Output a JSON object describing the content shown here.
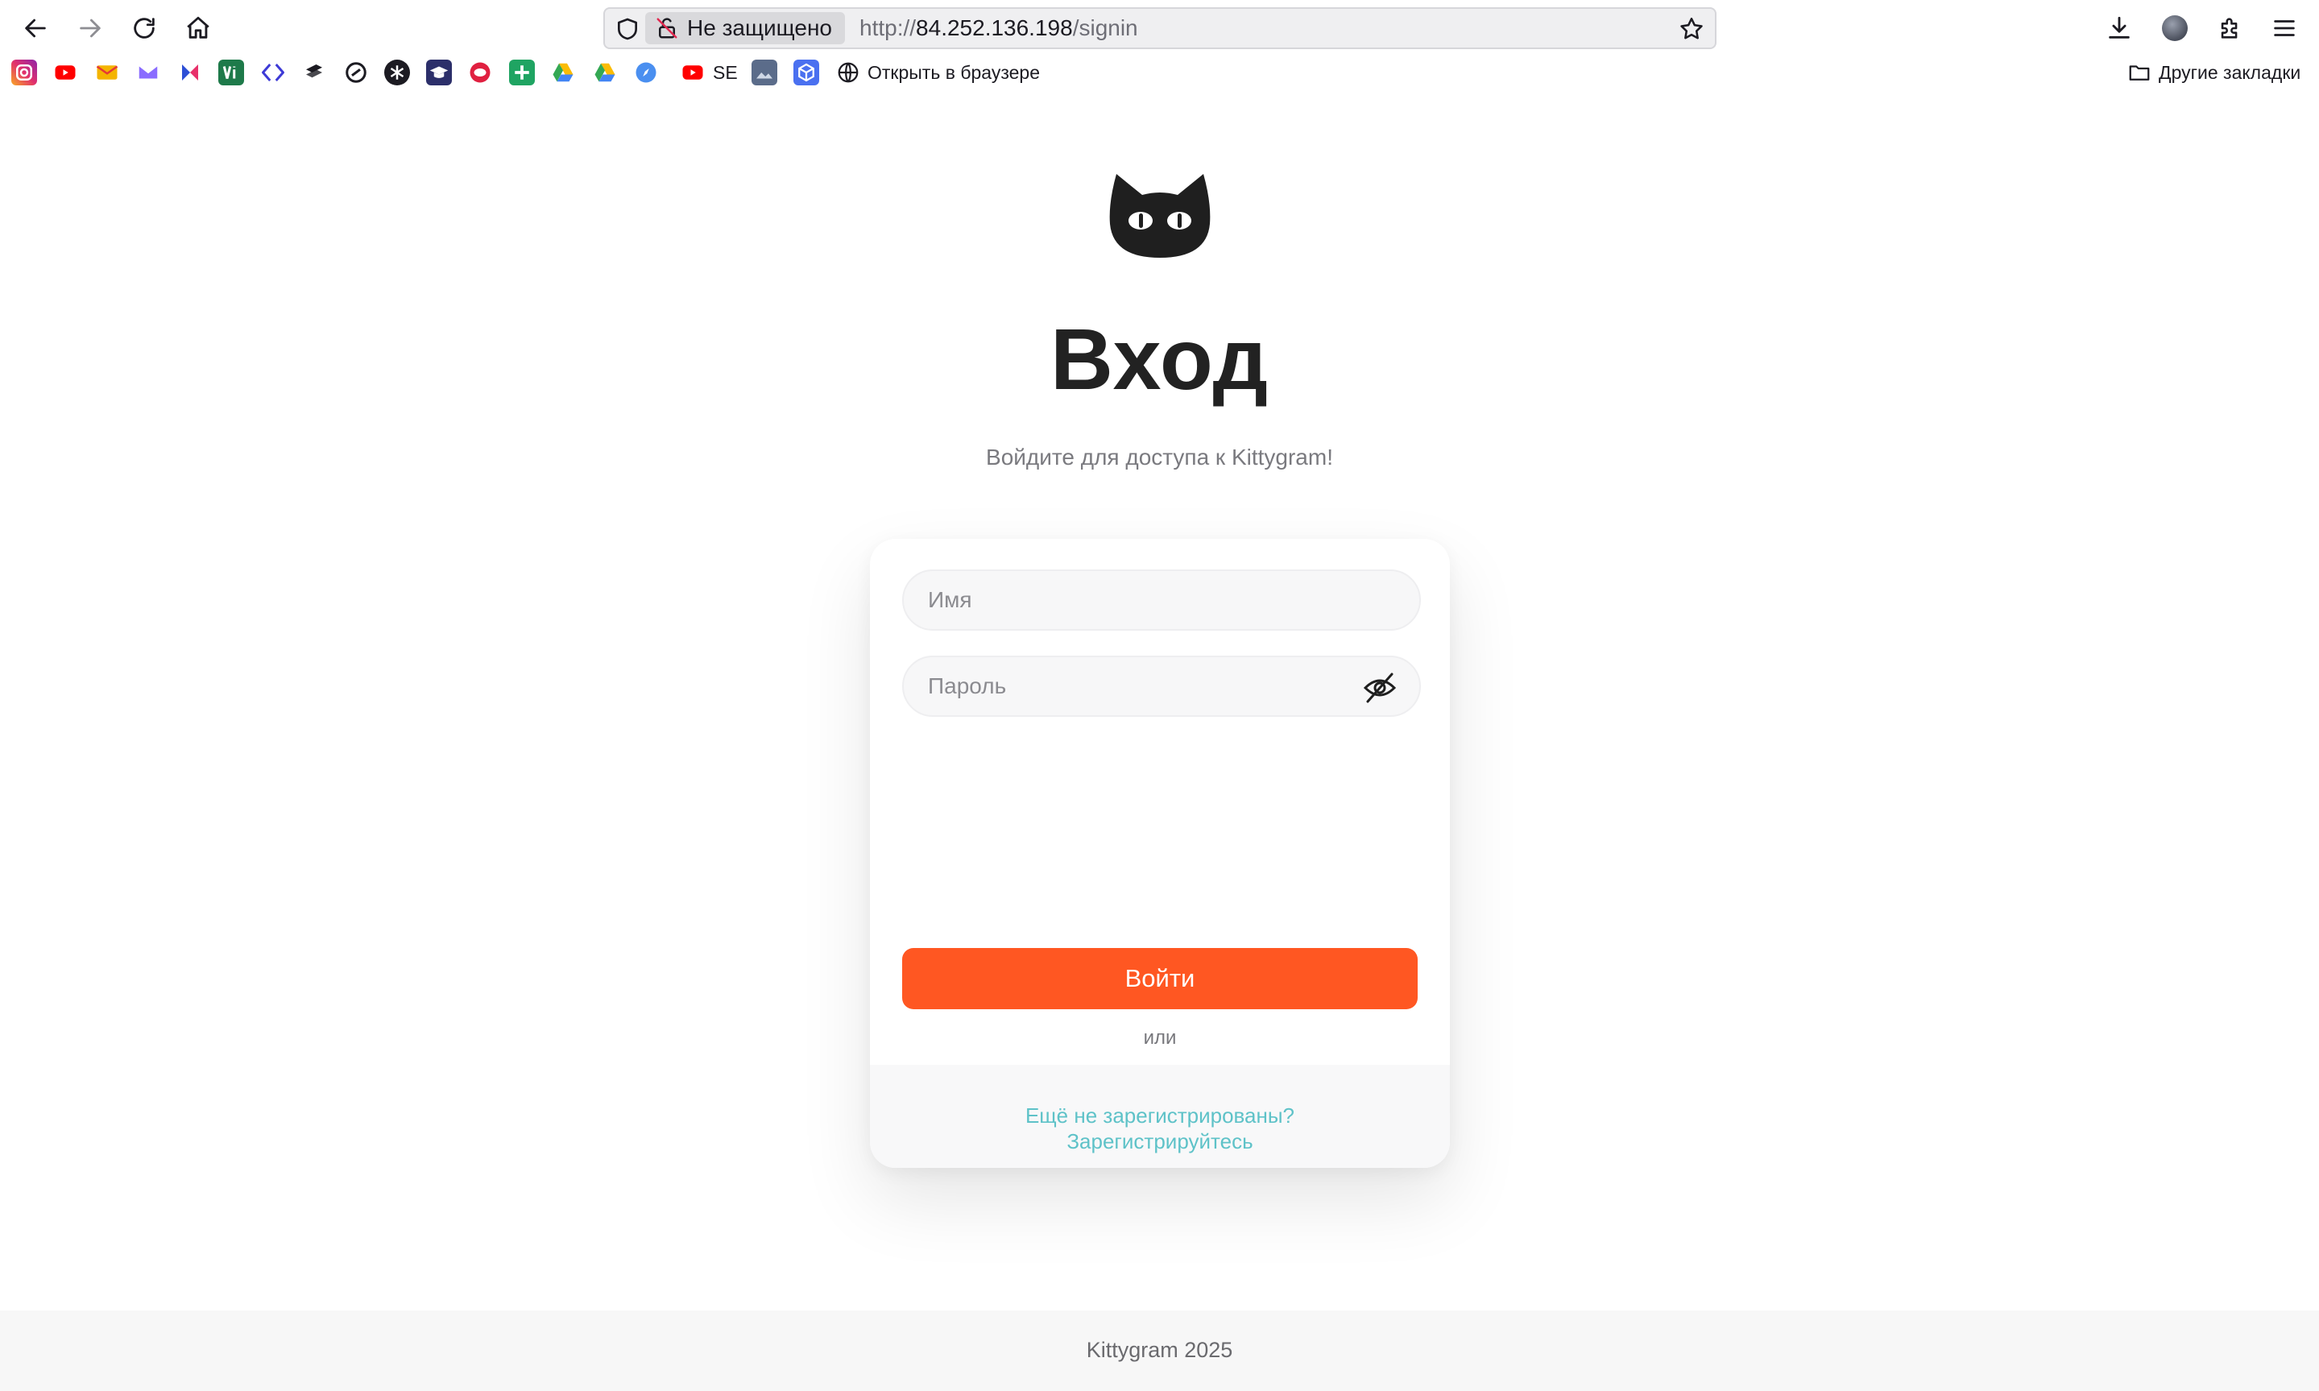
{
  "browser": {
    "security_label": "Не защищено",
    "url": {
      "scheme": "http://",
      "host": "84.252.136.198",
      "path": "/signin"
    },
    "bookmarks": [
      {
        "icon": "instagram-icon",
        "color": "#e1306c"
      },
      {
        "icon": "youtube-icon",
        "color": "#ff0000"
      },
      {
        "icon": "mail-icon",
        "color": "#f4b400"
      },
      {
        "icon": "proton-mail-icon",
        "color": "#8a6cff"
      },
      {
        "icon": "jira-icon",
        "color": "#2d4fd6"
      },
      {
        "icon": "vi-app-icon",
        "color": "#1e7a4a"
      },
      {
        "icon": "code-brackets-icon",
        "color": "#3d3ad6"
      },
      {
        "icon": "stack-icon",
        "color": "#1c1b22"
      },
      {
        "icon": "link-ring-icon",
        "color": "#1c1b22"
      },
      {
        "icon": "asterisk-icon",
        "color": "#1c1b22"
      },
      {
        "icon": "graduation-icon",
        "color": "#2c2f6a"
      },
      {
        "icon": "ring-icon",
        "color": "#e02040"
      },
      {
        "icon": "plus-sheet-icon",
        "color": "#1fa462"
      },
      {
        "icon": "drive-icon",
        "color": "#34a853"
      },
      {
        "icon": "drive-icon-2",
        "color": "#4285f4"
      },
      {
        "icon": "compass-icon",
        "color": "#4a8ff0"
      },
      {
        "icon": "youtube-se-icon",
        "color": "#ff0000"
      },
      {
        "icon": "picture-icon",
        "color": "#5b6c8a"
      },
      {
        "icon": "cube-icon",
        "color": "#4a70f0"
      },
      {
        "icon": "globe-icon",
        "color": "#1c1b22"
      }
    ],
    "bookmark_se_label": "SE",
    "bookmark_open_label": "Открыть в браузере",
    "other_bookmarks_label": "Другие закладки"
  },
  "page": {
    "title": "Вход",
    "subtitle": "Войдите для доступа к Kittygram!",
    "form": {
      "name_placeholder": "Имя",
      "password_placeholder": "Пароль",
      "submit_label": "Войти",
      "or_label": "или",
      "signup_line1": "Ещё не зарегистрированы?",
      "signup_line2": "Зарегистрируйтесь"
    },
    "footer": "Kittygram 2025",
    "accent_color": "#ff5722",
    "link_color": "#5ec2c8"
  }
}
